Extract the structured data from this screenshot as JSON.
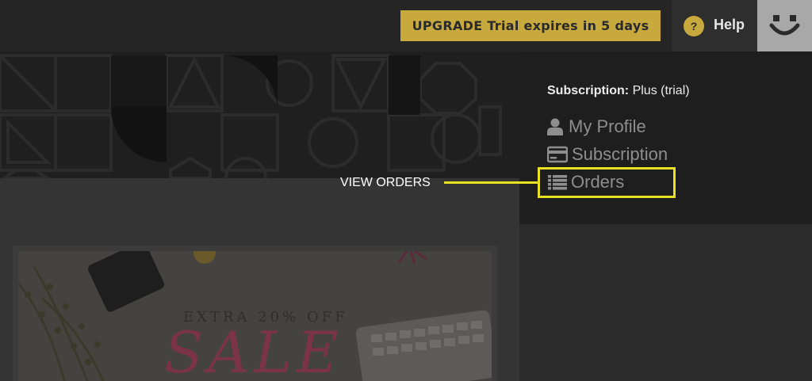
{
  "topbar": {
    "upgrade_label": "UPGRADE Trial expires in 5 days",
    "help_icon_glyph": "?",
    "help_label": "Help",
    "avatar_icon": "smiley-face-icon"
  },
  "dropdown": {
    "subscription_key": "Subscription:",
    "subscription_value": "Plus (trial)",
    "items": [
      {
        "label": "My Profile",
        "icon": "user-icon"
      },
      {
        "label": "Subscription",
        "icon": "credit-card-icon"
      },
      {
        "label": "Orders",
        "icon": "list-icon"
      }
    ]
  },
  "annotation": {
    "label": "VIEW ORDERS",
    "color": "#e8e023"
  },
  "card": {
    "extra_text": "EXTRA 20% OFF",
    "sale_text": "SALE"
  },
  "colors": {
    "accent": "#c8a93e"
  }
}
